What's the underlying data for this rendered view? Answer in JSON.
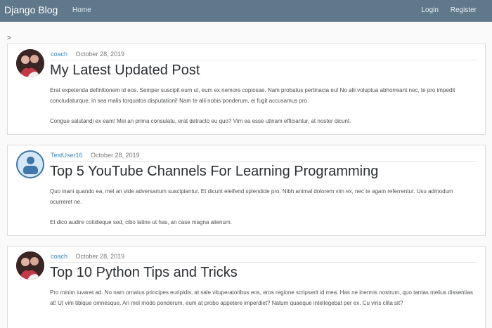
{
  "navbar": {
    "brand": "Django Blog",
    "home": "Home",
    "login": "Login",
    "register": "Register"
  },
  "breadcrumb": ">",
  "posts": [
    {
      "author": "coach",
      "date": "October 28, 2019",
      "title": "My Latest Updated Post",
      "paragraphs": [
        "Erat expetenda definitionem id eos. Semper suscipit eum ut, eum ex nemore copiosae. Nam probatus pertinacia eu! No alii voluptua abhorreant nec, te pro impedit concludaturque, in sea malis torquatos disputationi! Nam te alii nobis ponderum, ei fugit accusamus pro.",
        "Congue salutandi ex eam! Mei an prima consulatu, erat detracto eu quo? Vim ea esse utinam efficiantur, at noster dicunt."
      ]
    },
    {
      "author": "TestUser16",
      "date": "October 28, 2019",
      "title": "Top 5 YouTube Channels For Learning Programming",
      "paragraphs": [
        "Quo inani quando ea, mel an vide adversarium suscipiantur. Et dicunt eleifend splendide pro. Nibh animal dolorem vim ex, nec te agam referrentur. Usu admodum ocurreret ne.",
        "Et dico audire cotidieque sed, cibo latine ut has, an case magna alienum."
      ]
    },
    {
      "author": "coach",
      "date": "October 28, 2019",
      "title": "Top 10 Python Tips and Tricks",
      "paragraphs": [
        "Pro minim iuvaret ad. No nam ornatus principes euripidis, at sale vituperatoribus eos, eros regione scripserit id mea. Has ne inermis nostrum, quo tantas melius dissentias at! Ut vim tibique omnesque. An mel modo ponderum, eum at probo appetere imperdiet? Natum quaeque intellegebat per ex. Cu viris clita sit?"
      ]
    }
  ]
}
